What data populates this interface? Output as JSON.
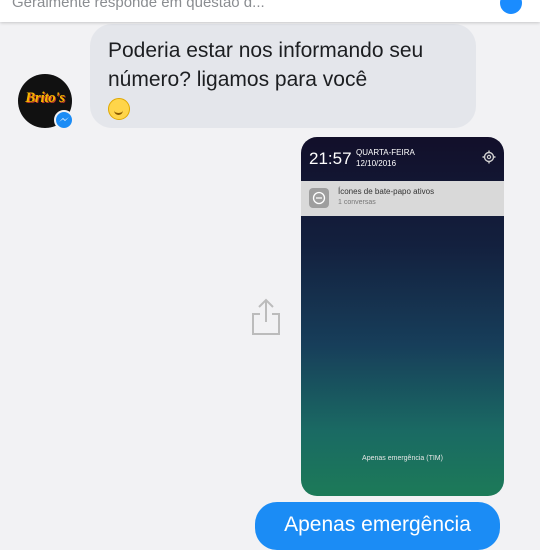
{
  "header": {
    "status_text": "Geralmente responde em questão d..."
  },
  "contact": {
    "avatar_text": "Brito's"
  },
  "messages": {
    "incoming": {
      "text": "Poderia estar nos informando seu número? ligamos para você",
      "emoji": "slightly-smiling-face"
    },
    "outgoing": {
      "text": "Apenas emergência"
    }
  },
  "attachment": {
    "lock_time": "21:57",
    "weekday": "QUARTA-FEIRA",
    "date": "12/10/2016",
    "notification_title": "Ícones de bate-papo ativos",
    "notification_sub": "1 conversas",
    "emergency_text": "Apenas emergência (TIM)"
  },
  "colors": {
    "outgoing_bubble": "#1b8cf5",
    "incoming_bubble": "#e4e6eb",
    "background": "#f2f2f4"
  }
}
